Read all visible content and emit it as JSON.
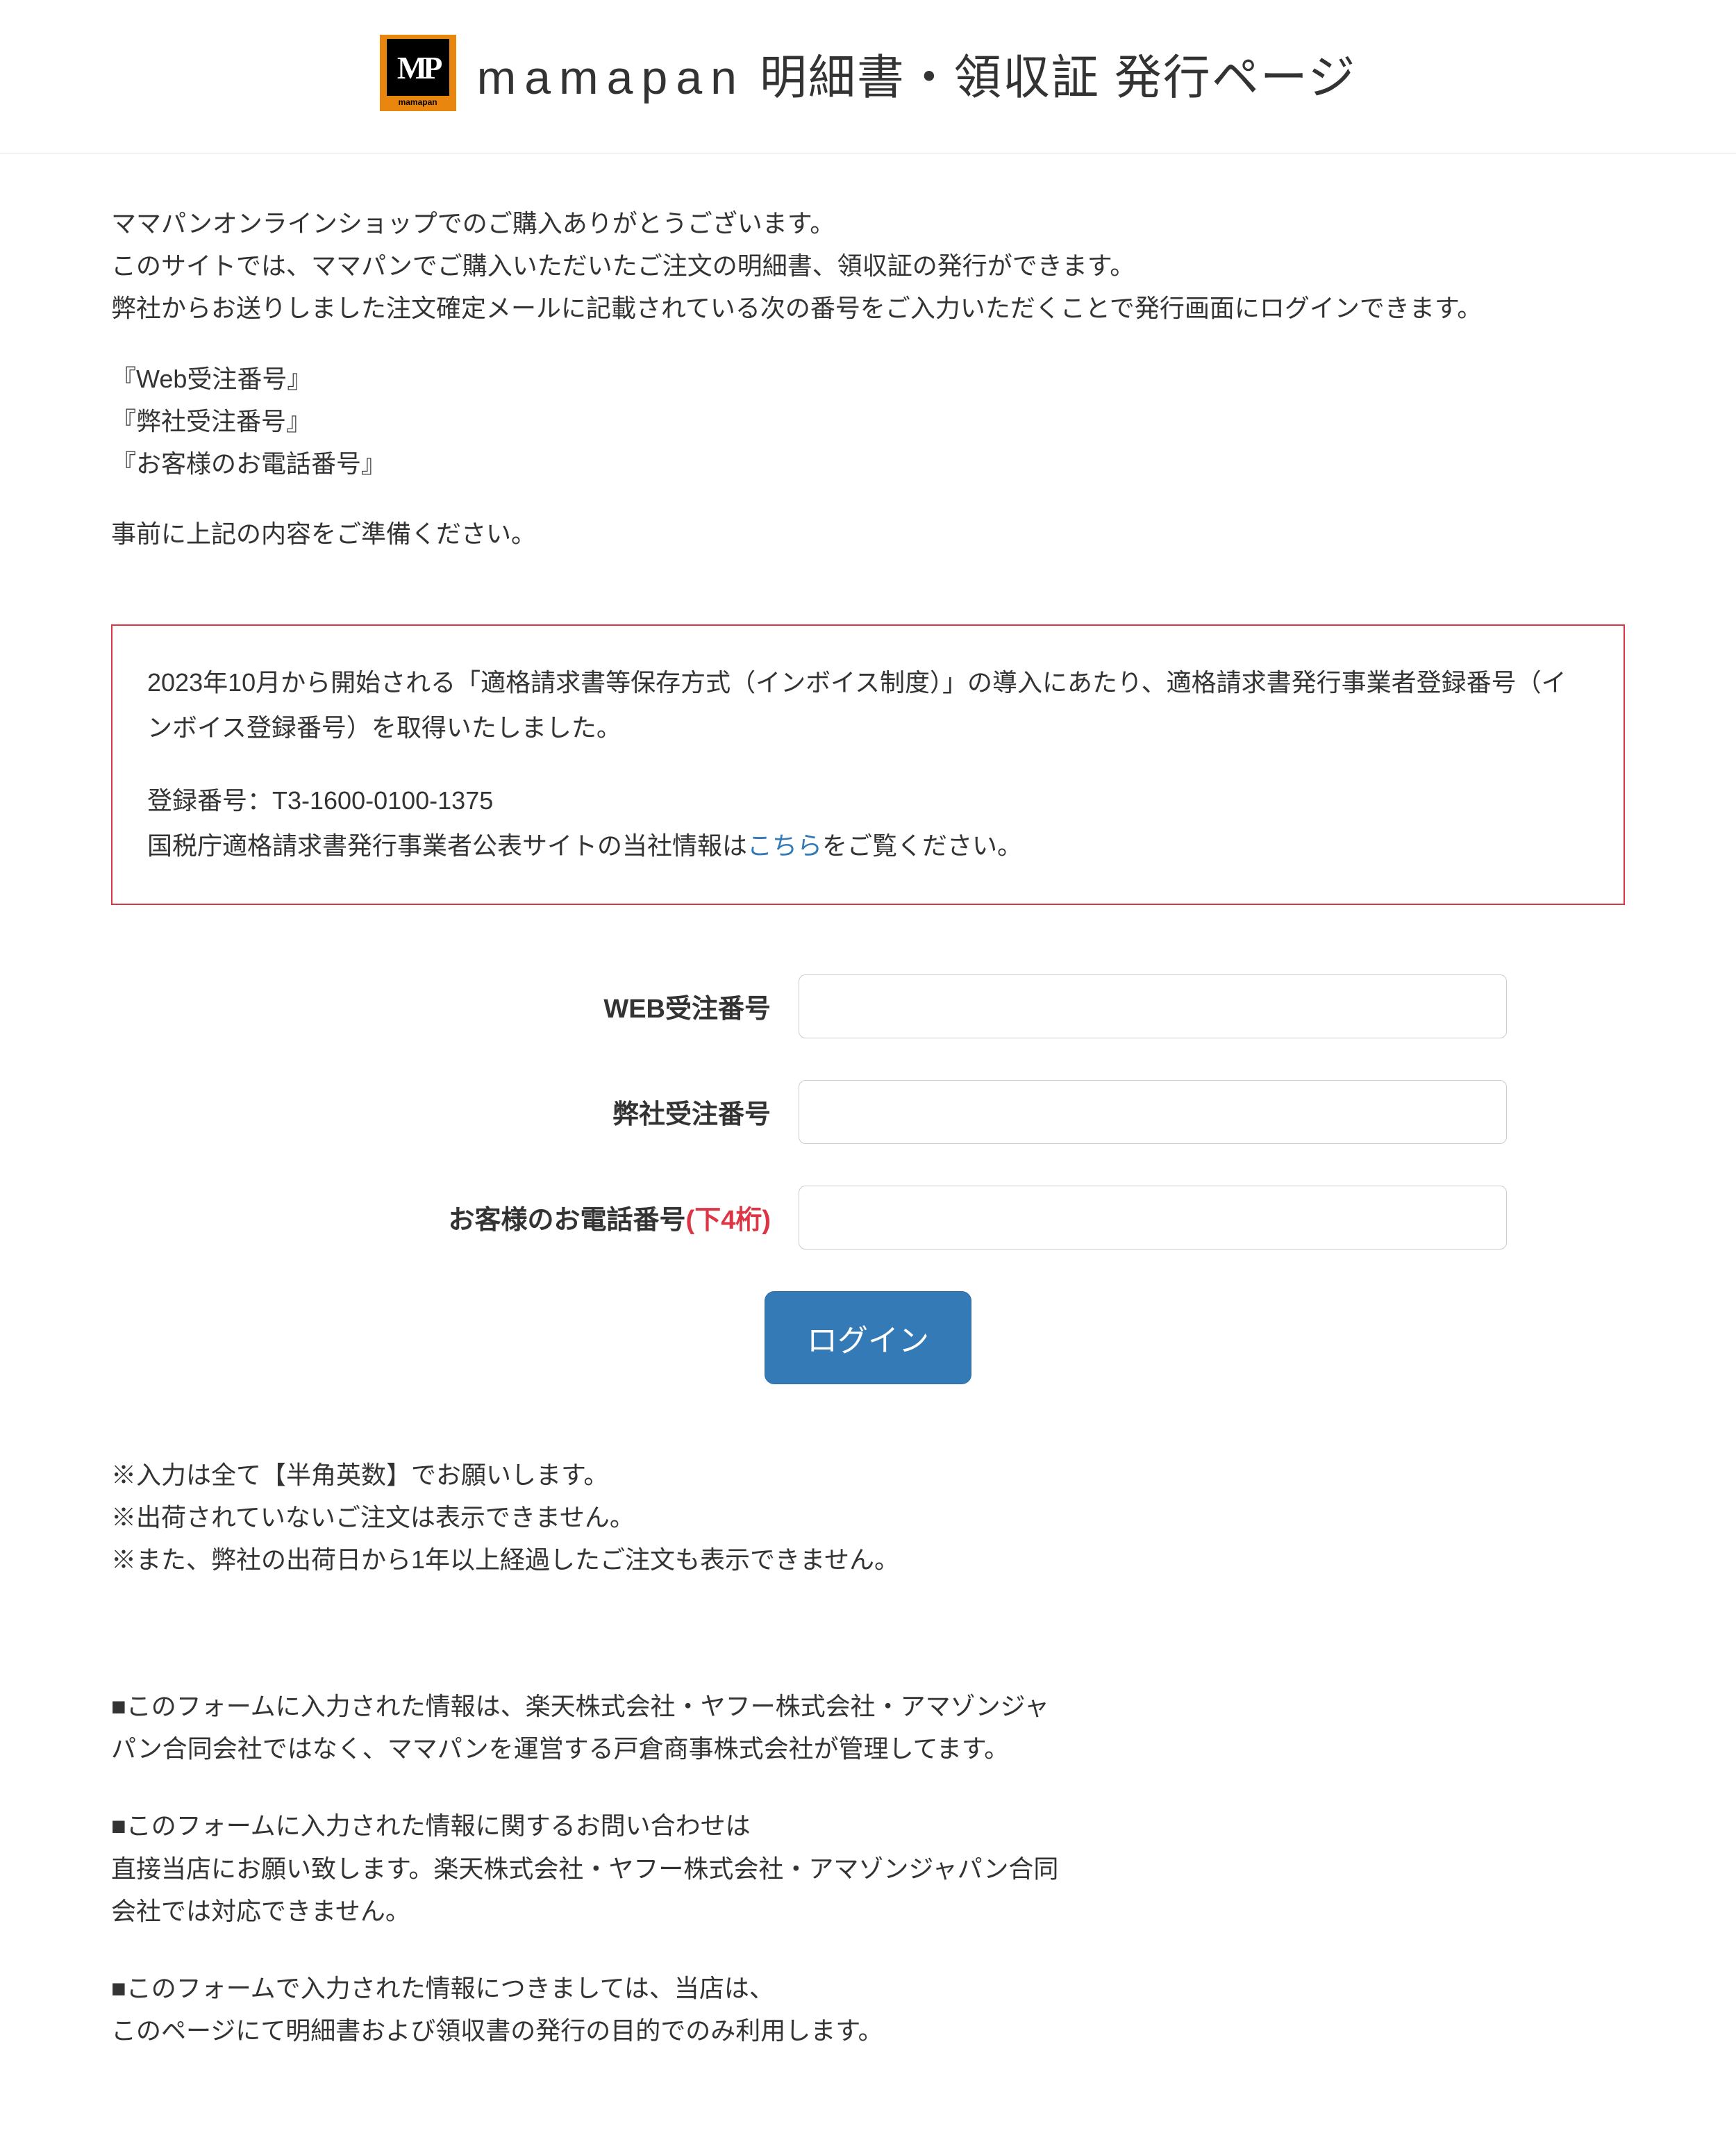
{
  "header": {
    "logo_main": "MP",
    "logo_sub": "mamapan",
    "brand": "mamapan",
    "title_suffix": " 明細書・領収証 発行ページ"
  },
  "intro": {
    "line1": "ママパンオンラインショップでのご購入ありがとうございます。",
    "line2": "このサイトでは、ママパンでご購入いただいたご注文の明細書、領収証の発行ができます。",
    "line3": "弊社からお送りしました注文確定メールに記載されている次の番号をご入力いただくことで発行画面にログインできます。",
    "item1": "『Web受注番号』",
    "item2": "『弊社受注番号』",
    "item3": "『お客様のお電話番号』",
    "line4": "事前に上記の内容をご準備ください。"
  },
  "notice": {
    "line1": "2023年10月から開始される「適格請求書等保存方式（インボイス制度）」の導入にあたり、適格請求書発行事業者登録番号（インボイス登録番号）を取得いたしました。",
    "reg_label": "登録番号：",
    "reg_number": "T3-1600-0100-1375",
    "link_before": "国税庁適格請求書発行事業者公表サイトの当社情報は",
    "link_text": "こちら",
    "link_after": "をご覧ください。"
  },
  "form": {
    "web_order_label": "WEB受注番号",
    "company_order_label": "弊社受注番号",
    "phone_label_prefix": "お客様のお電話番号",
    "phone_label_suffix": "(下4桁)",
    "login_button": "ログイン"
  },
  "notes": {
    "line1": "※入力は全て【半角英数】でお願いします。",
    "line2": "※出荷されていないご注文は表示できません。",
    "line3": "※また、弊社の出荷日から1年以上経過したご注文も表示できません。"
  },
  "disclaimer": {
    "block1_line1": "■このフォームに入力された情報は、楽天株式会社・ヤフー株式会社・アマゾンジャ",
    "block1_line2": "パン合同会社ではなく、ママパンを運営する戸倉商事株式会社が管理してます。",
    "block2_line1": "■このフォームに入力された情報に関するお問い合わせは",
    "block2_line2": "直接当店にお願い致します。楽天株式会社・ヤフー株式会社・アマゾンジャパン合同",
    "block2_line3": "会社では対応できません。",
    "block3_line1": "■このフォームで入力された情報につきましては、当店は、",
    "block3_line2": "このページにて明細書および領収書の発行の目的でのみ利用します。"
  }
}
